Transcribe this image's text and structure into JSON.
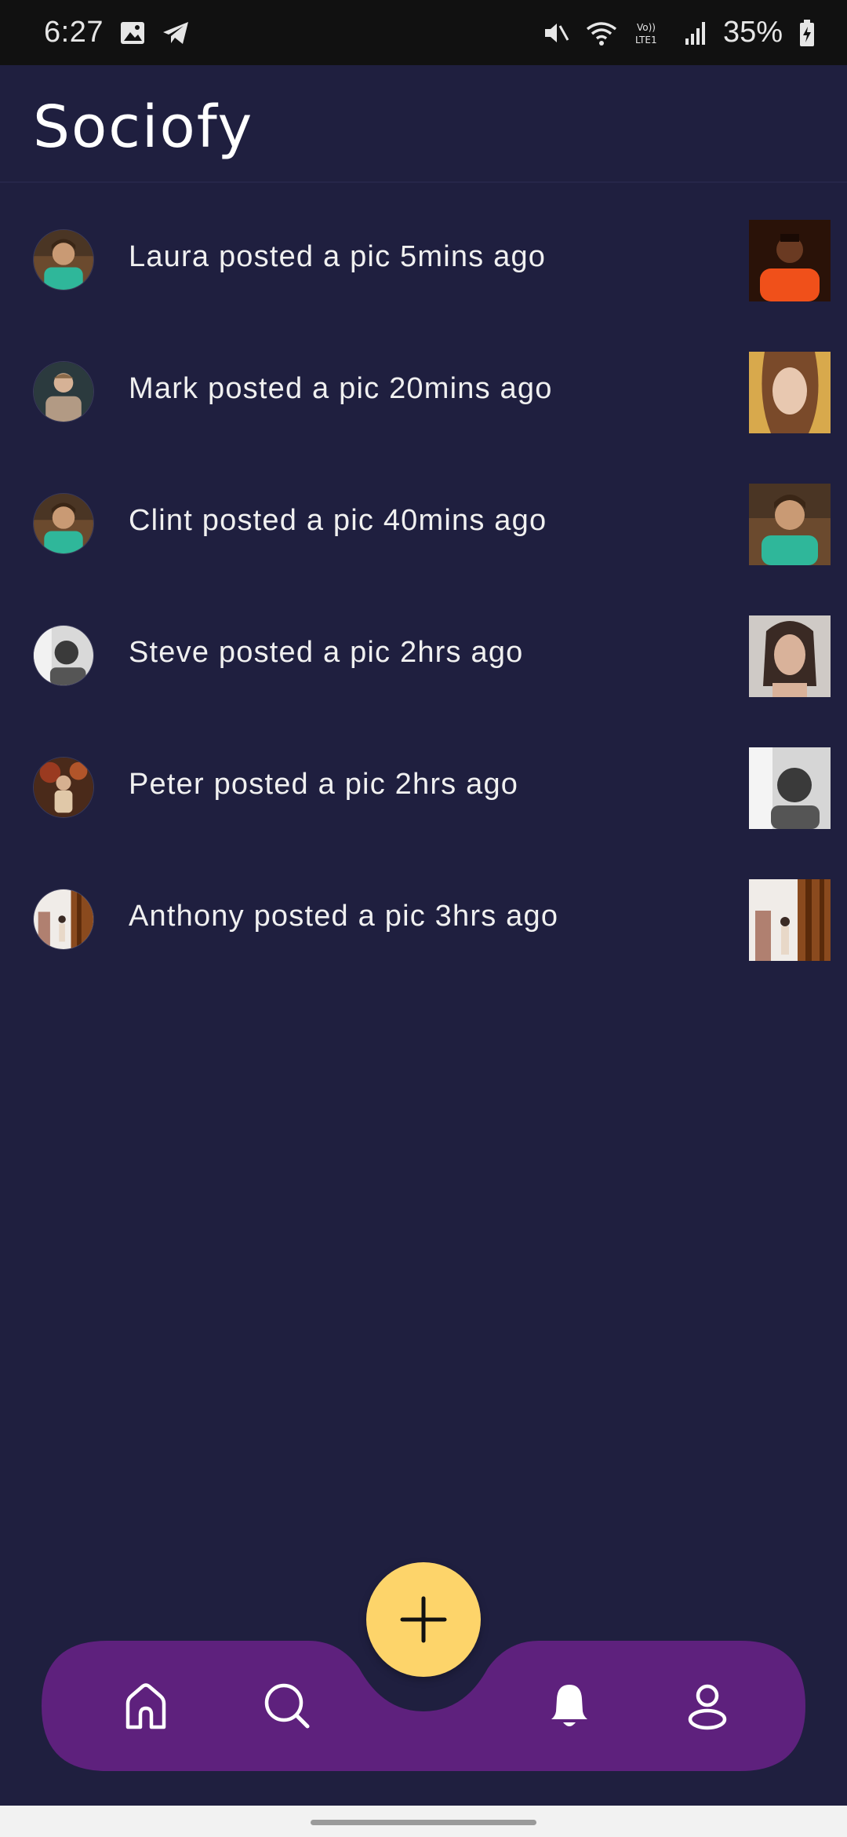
{
  "status_bar": {
    "time": "6:27",
    "battery_percent": "35%",
    "icons": [
      "image-icon",
      "telegram-icon",
      "mute-icon",
      "wifi-icon",
      "volte-icon",
      "signal-icon",
      "battery-icon"
    ]
  },
  "app": {
    "title": "Sociofy"
  },
  "feed": {
    "items": [
      {
        "text": "Laura posted a pic 5mins ago"
      },
      {
        "text": "Mark posted a pic 20mins ago"
      },
      {
        "text": "Clint posted a pic 40mins ago"
      },
      {
        "text": "Steve posted a pic 2hrs ago"
      },
      {
        "text": "Peter posted a pic 2hrs ago"
      },
      {
        "text": "Anthony posted a pic 3hrs ago"
      }
    ]
  },
  "bottom_nav": {
    "items": [
      "home-icon",
      "search-icon",
      "bell-icon",
      "profile-icon"
    ],
    "fab_icon": "plus-icon",
    "active": "bell-icon"
  },
  "colors": {
    "background": "#1f1f3f",
    "nav_bar": "#5e217d",
    "fab": "#fdd46a",
    "text": "#f0f0f0"
  }
}
